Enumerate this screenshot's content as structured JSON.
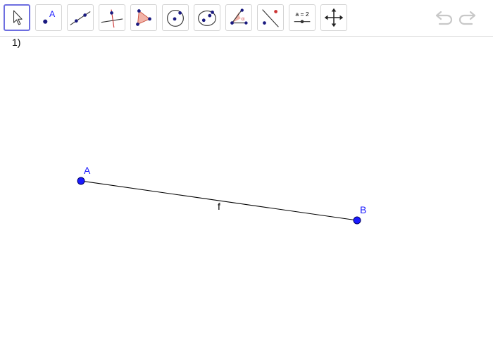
{
  "toolbar": {
    "tools": [
      {
        "icon": "move-arrow-icon",
        "selected": true
      },
      {
        "icon": "point-icon",
        "glyph": "A"
      },
      {
        "icon": "line-icon"
      },
      {
        "icon": "perpendicular-line-icon"
      },
      {
        "icon": "polygon-icon"
      },
      {
        "icon": "circle-center-point-icon"
      },
      {
        "icon": "conic-ellipse-icon"
      },
      {
        "icon": "angle-icon",
        "glyph": "α"
      },
      {
        "icon": "reflect-about-line-icon"
      },
      {
        "icon": "slider-icon",
        "glyph": "a = 2"
      },
      {
        "icon": "move-graphics-view-icon"
      }
    ],
    "undo_icon": "undo-icon",
    "redo_icon": "redo-icon"
  },
  "construction": {
    "label": "1)"
  },
  "objects": {
    "point_a": {
      "label": "A",
      "x": -3.8,
      "y": 0.5
    },
    "point_b": {
      "label": "B",
      "x": 1.8,
      "y": -0.3
    },
    "segment": {
      "label": "f",
      "from": "A",
      "to": "B"
    }
  },
  "colors": {
    "point": "#1a1aff",
    "segment": "#000000",
    "selected_tool": "#6d6ee0"
  }
}
